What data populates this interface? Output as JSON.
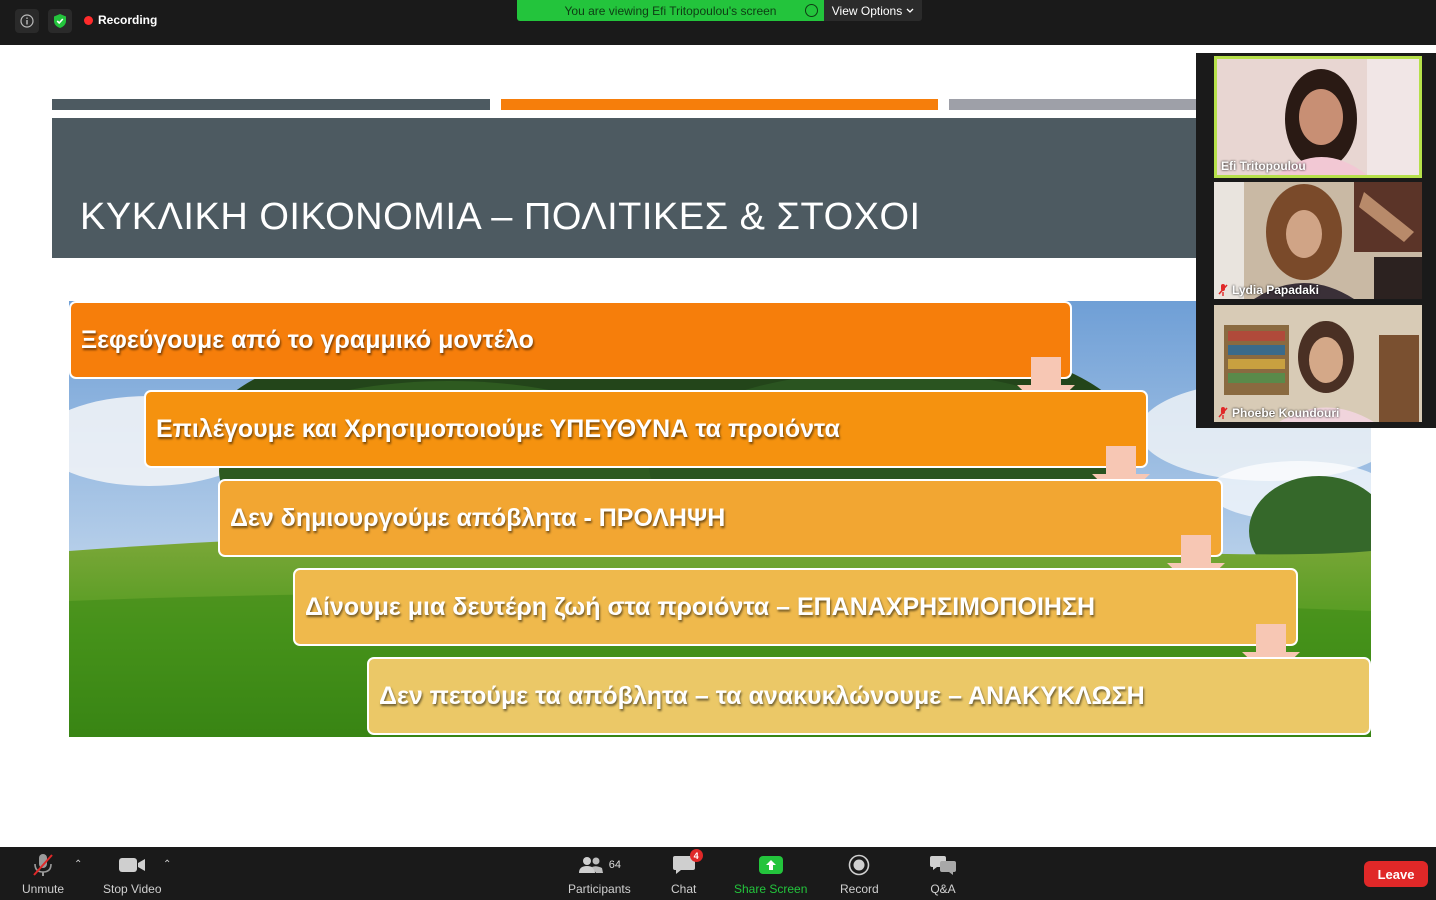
{
  "topbar": {
    "recording_label": "Recording",
    "viewing_banner": "You are viewing Efi Tritopoulou's screen",
    "view_options_label": "View Options"
  },
  "slide": {
    "title": "ΚΥΚΛΙΚΗ ΟΙΚΟΝΟΜΙΑ – ΠΟΛΙΤΙΚΕΣ & ΣΤΟΧΟΙ",
    "steps": [
      "Ξεφεύγουμε από το γραμμικό μοντέλο",
      "Επιλέγουμε και Χρησιμοποιούμε ΥΠΕΥΘΥΝΑ τα προιόντα",
      "Δεν δημιουργούμε απόβλητα - ΠΡΟΛΗΨΗ",
      "Δίνουμε μια δευτέρη ζωή στα προιόντα – ΕΠΑΝΑΧΡΗΣΙΜΟΠΟΙΗΣΗ",
      "Δεν πετούμε τα απόβλητα – τα ανακυκλώνουμε – ΑΝΑΚΥΚΛΩΣΗ"
    ],
    "step_colors": [
      "#f67e0b",
      "#f5920f",
      "#f2a632",
      "#efb94c",
      "#ebc867"
    ],
    "accent_bars": [
      "#4d5a61",
      "#f67e0b",
      "#9ea0a8"
    ]
  },
  "participants": [
    {
      "name": "Efi Tritopoulou",
      "muted": false,
      "active_speaker": true
    },
    {
      "name": "Lydia Papadaki",
      "muted": true,
      "active_speaker": false
    },
    {
      "name": "Phoebe Koundouri",
      "muted": true,
      "active_speaker": false
    }
  ],
  "toolbar": {
    "unmute_label": "Unmute",
    "stop_video_label": "Stop Video",
    "participants_label": "Participants",
    "participants_count": "64",
    "chat_label": "Chat",
    "chat_badge": "4",
    "share_screen_label": "Share Screen",
    "record_label": "Record",
    "qa_label": "Q&A",
    "leave_label": "Leave"
  }
}
